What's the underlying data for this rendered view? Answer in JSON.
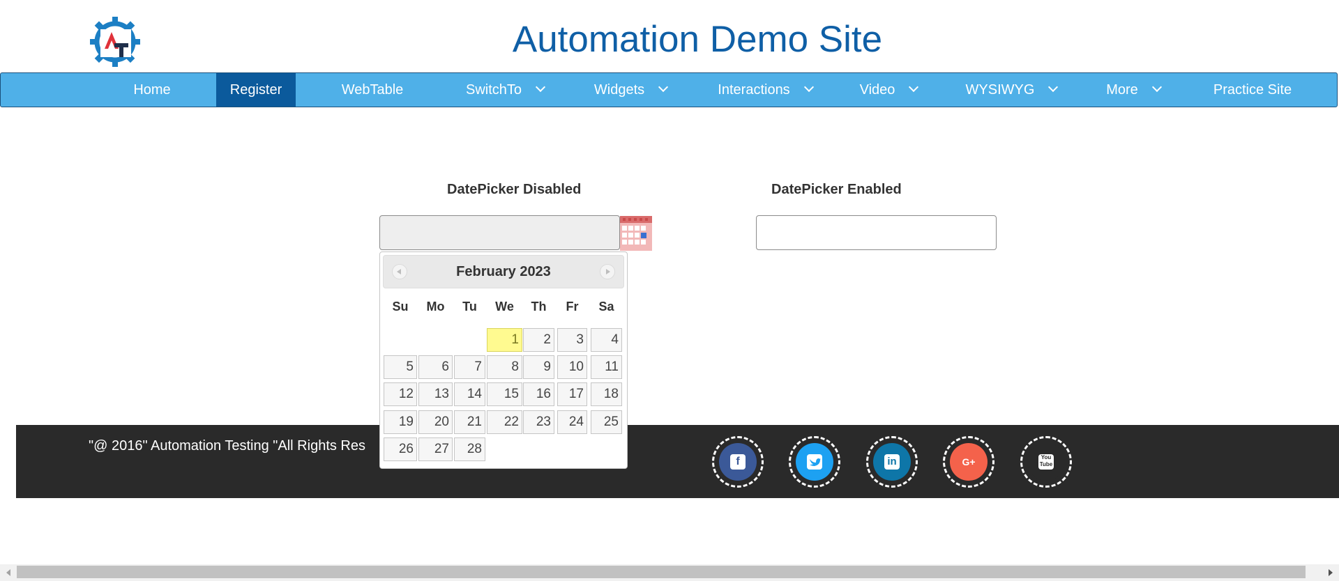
{
  "site": {
    "title": "Automation Demo Site"
  },
  "nav": {
    "items": [
      {
        "label": "Home",
        "dropdown": false,
        "active": false
      },
      {
        "label": "Register",
        "dropdown": false,
        "active": true
      },
      {
        "label": "WebTable",
        "dropdown": false,
        "active": false
      },
      {
        "label": "SwitchTo",
        "dropdown": true,
        "active": false
      },
      {
        "label": "Widgets",
        "dropdown": true,
        "active": false
      },
      {
        "label": "Interactions",
        "dropdown": true,
        "active": false
      },
      {
        "label": "Video",
        "dropdown": true,
        "active": false
      },
      {
        "label": "WYSIWYG",
        "dropdown": true,
        "active": false
      },
      {
        "label": "More",
        "dropdown": true,
        "active": false
      },
      {
        "label": "Practice Site",
        "dropdown": false,
        "active": false
      }
    ]
  },
  "datepicker_disabled": {
    "label": "DatePicker Disabled",
    "value": ""
  },
  "datepicker_enabled": {
    "label": "DatePicker Enabled",
    "value": ""
  },
  "calendar": {
    "month_year": "February 2023",
    "weekdays": [
      "Su",
      "Mo",
      "Tu",
      "We",
      "Th",
      "Fr",
      "Sa"
    ],
    "first_weekday_index": 3,
    "days": [
      "1",
      "2",
      "3",
      "4",
      "5",
      "6",
      "7",
      "8",
      "9",
      "10",
      "11",
      "12",
      "13",
      "14",
      "15",
      "16",
      "17",
      "18",
      "19",
      "20",
      "21",
      "22",
      "23",
      "24",
      "25",
      "26",
      "27",
      "28"
    ],
    "highlighted_day": "1"
  },
  "footer": {
    "copyright": "\"@ 2016\" Automation Testing \"All Rights Res",
    "social": [
      {
        "name": "facebook-icon",
        "color": "#3b5998",
        "glyph": "f"
      },
      {
        "name": "twitter-icon",
        "color": "#1da1f2",
        "glyph": "t"
      },
      {
        "name": "linkedin-icon",
        "color": "#0e76a8",
        "glyph": "in"
      },
      {
        "name": "google-plus-icon",
        "color": "#f4624b",
        "glyph": "G+"
      },
      {
        "name": "youtube-icon",
        "color": "#2a2a2a",
        "glyph": "You Tube"
      }
    ]
  },
  "colors": {
    "nav_bg": "#4fb0e8",
    "nav_active": "#0b5a9c",
    "title": "#0f5fa6",
    "footer_bg": "#2a2a2a",
    "today_bg": "#fffa90"
  }
}
